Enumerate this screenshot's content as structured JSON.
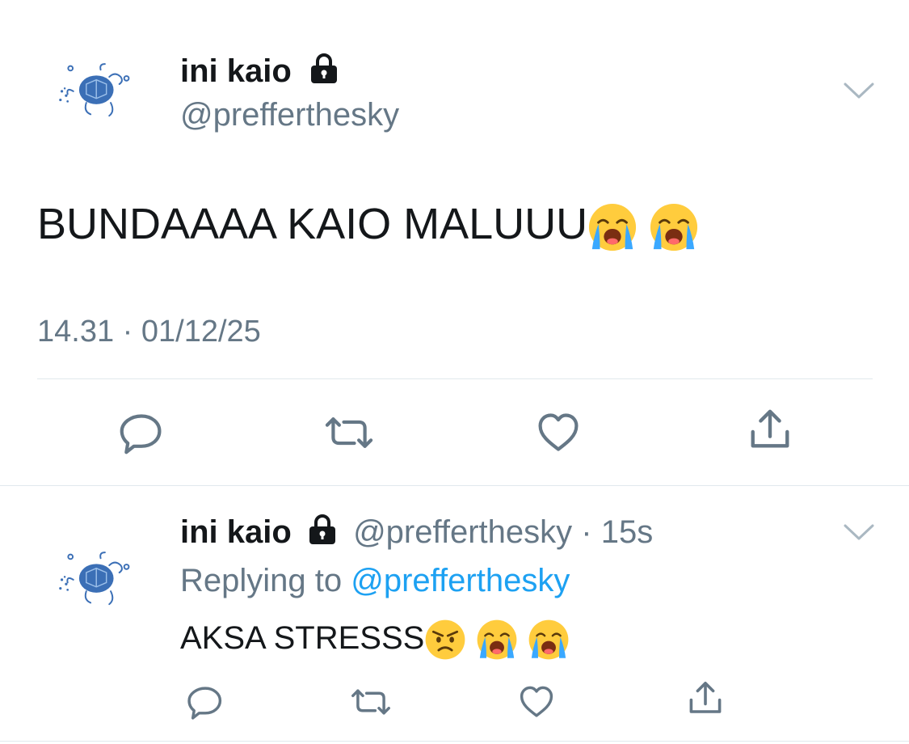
{
  "main_tweet": {
    "display_name": "ini kaio",
    "username": "@prefferthesky",
    "text": "BUNDAAAA KAIO MALUUU",
    "emojis": [
      "loudly-crying-face",
      "loudly-crying-face"
    ],
    "timestamp": "14.31 · 01/12/25",
    "actions": [
      "reply-icon",
      "retweet-icon",
      "like-icon",
      "share-icon"
    ]
  },
  "reply_tweet": {
    "display_name": "ini kaio",
    "username": "@prefferthesky",
    "separator": "·",
    "time_ago": "15s",
    "replying_prefix": "Replying to",
    "replying_handle": "@prefferthesky",
    "text": "AKSA STRESSS",
    "emojis": [
      "angry-face",
      "loudly-crying-face",
      "loudly-crying-face"
    ],
    "actions": [
      "reply-icon",
      "retweet-icon",
      "like-icon",
      "share-icon"
    ]
  },
  "colors": {
    "text": "#14171a",
    "muted": "#657786",
    "link": "#1da1f2",
    "divider": "#e1e8ed",
    "avatar_turtle": "#3b6fb6"
  }
}
